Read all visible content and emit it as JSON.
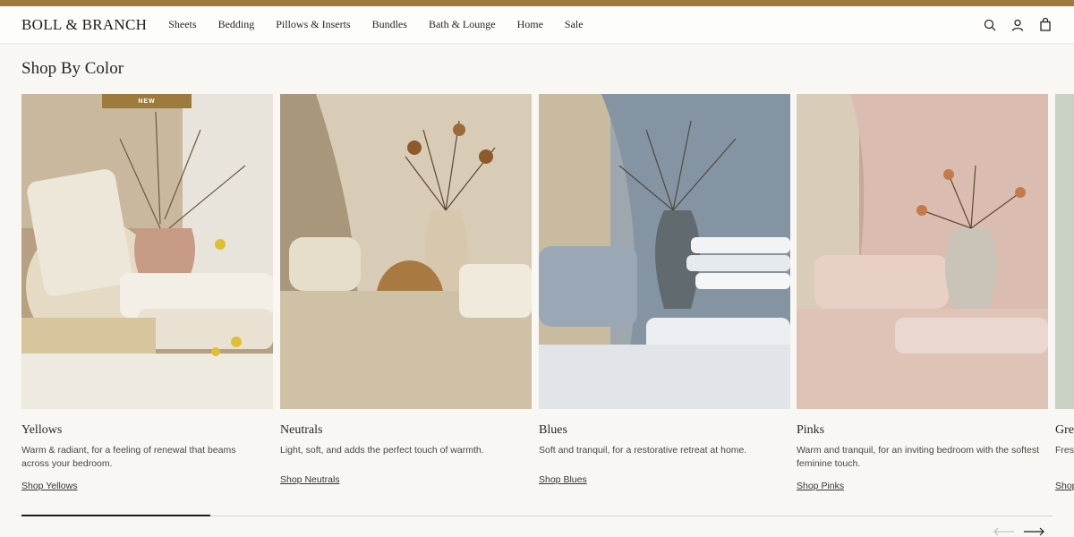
{
  "header": {
    "logo": "BOLL & BRANCH",
    "nav": [
      "Sheets",
      "Bedding",
      "Pillows & Inserts",
      "Bundles",
      "Bath & Lounge",
      "Home",
      "Sale"
    ],
    "icons": [
      "search-icon",
      "account-icon",
      "bag-icon"
    ]
  },
  "section": {
    "title": "Shop By Color"
  },
  "cards": [
    {
      "title": "Yellows",
      "badge": "NEW",
      "description": "Warm & radiant, for a feeling of renewal that beams across your bedroom.",
      "link": "Shop Yellows",
      "colors": {
        "bg": "#c7b294",
        "accent": "#e8dfc9"
      }
    },
    {
      "title": "Neutrals",
      "description": "Light, soft, and adds the perfect touch of warmth.",
      "link": "Shop Neutrals",
      "colors": {
        "bg": "#c9bca4",
        "accent": "#e3dac8"
      }
    },
    {
      "title": "Blues",
      "description": "Soft and tranquil, for a restorative retreat at home.",
      "link": "Shop Blues",
      "colors": {
        "bg": "#8e9aa6",
        "accent": "#dfe3e7"
      }
    },
    {
      "title": "Pinks",
      "description": "Warm and tranquil, for an inviting bedroom with the softest feminine touch.",
      "link": "Shop Pinks",
      "colors": {
        "bg": "#d8b7ab",
        "accent": "#ecd7cf"
      }
    },
    {
      "title": "Greens",
      "description": "Fresh and calm, for a natural atmosphere.",
      "link": "Shop Greens",
      "colors": {
        "bg": "#93a08c",
        "accent": "#c9d1c3"
      }
    }
  ],
  "carousel": {
    "progress": 0.18
  },
  "colors": {
    "brand": "#9c7b3c",
    "text": "#2a2623"
  }
}
